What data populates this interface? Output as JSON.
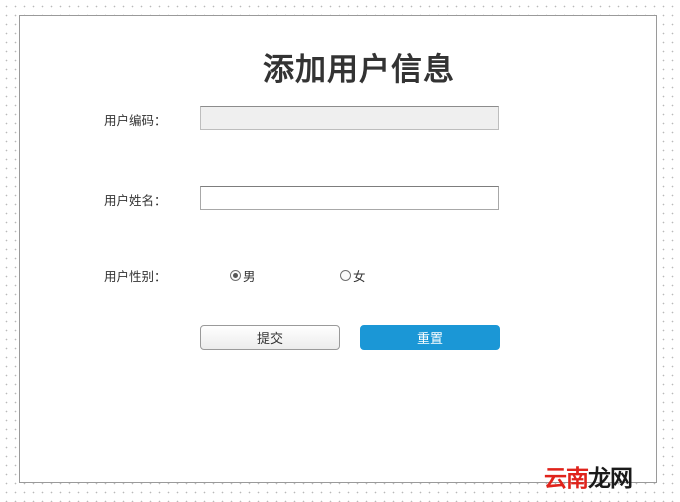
{
  "form": {
    "title": "添加用户信息",
    "fields": {
      "user_code": {
        "label": "用户编码：",
        "value": "",
        "placeholder": ""
      },
      "user_name": {
        "label": "用户姓名：",
        "value": "",
        "placeholder": ""
      },
      "gender": {
        "label": "用户性别：",
        "options": [
          {
            "label": "男",
            "checked": true
          },
          {
            "label": "女",
            "checked": false
          }
        ]
      }
    },
    "buttons": {
      "submit_label": "提交",
      "reset_label": "重置"
    }
  },
  "watermark": {
    "part1": "云南",
    "part2": "龙网"
  },
  "colors": {
    "reset_button_bg": "#1b97d6",
    "watermark_red": "#e0231b"
  }
}
